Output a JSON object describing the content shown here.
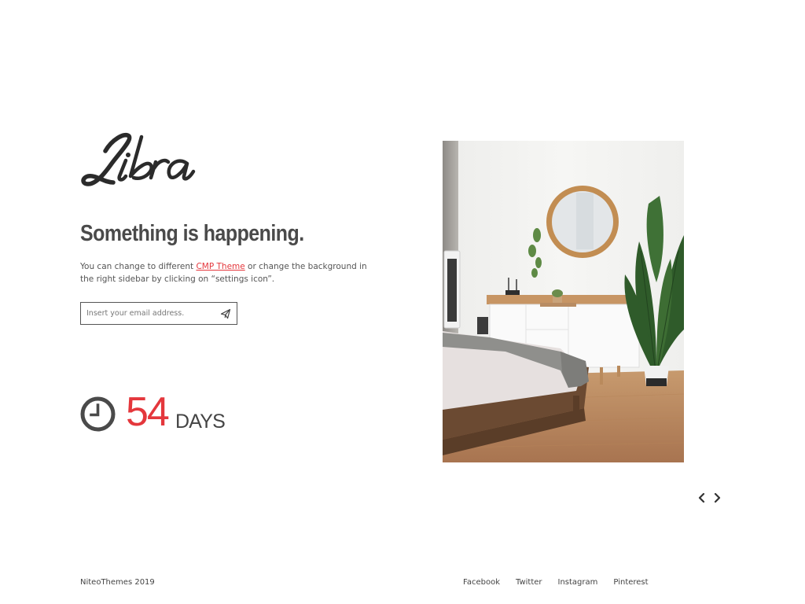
{
  "brand": {
    "logo_text": "Libra"
  },
  "content": {
    "headline": "Something is happening.",
    "description": {
      "before_link": "You can change to different ",
      "link": "CMP Theme",
      "after_link": " or change the background in the right sidebar by clicking on “settings icon”."
    }
  },
  "subscribe": {
    "placeholder": "Insert your email address.",
    "submit_icon": "paper-plane-icon"
  },
  "countdown": {
    "value": "54",
    "unit": "DAYS",
    "icon": "clock-icon"
  },
  "slider": {
    "prev_icon": "chevron-left-icon",
    "next_icon": "chevron-right-icon"
  },
  "footer": {
    "copyright": "NiteoThemes 2019",
    "social": [
      "Facebook",
      "Twitter",
      "Instagram",
      "Pinterest"
    ]
  },
  "colors": {
    "accent": "#e4373c",
    "text": "#444444",
    "background": "#ffffff"
  }
}
